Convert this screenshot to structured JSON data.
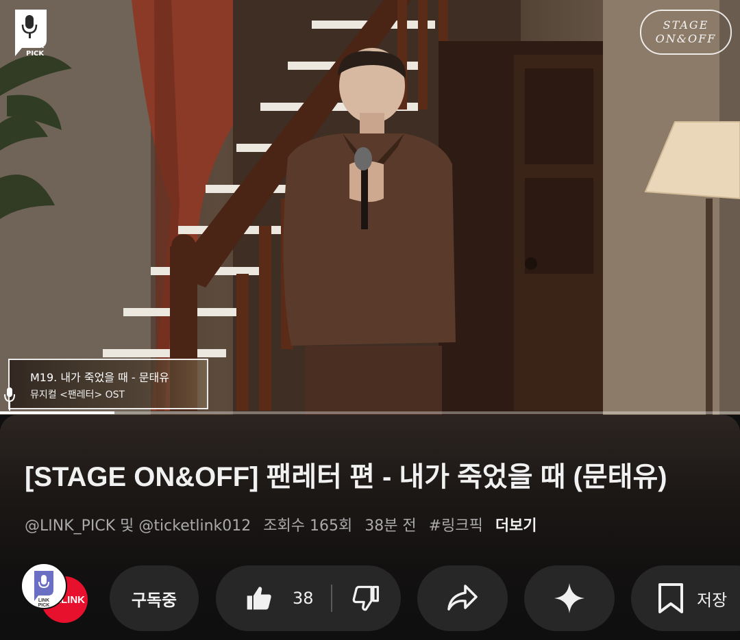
{
  "player": {
    "channel_logo_text": [
      "LINK",
      "PICK"
    ],
    "stage_badge": [
      "STAGE",
      "ON&OFF"
    ],
    "caption": {
      "title": "M19. 내가 죽었을 때 - 문태유",
      "subtitle": "뮤지컬 <팬레터> OST"
    },
    "progress_fraction": 0.155
  },
  "video": {
    "title": "[STAGE ON&OFF] 팬레터 편 - 내가 죽었을 때 (문태유)",
    "channels": "@LINK_PICK 및 @ticketlink012",
    "views": "조회수 165회",
    "time_ago": "38분 전",
    "hashtag": "#링크픽",
    "more_label": "더보기"
  },
  "actions": {
    "avatar_link_text": "tLINK",
    "subscribe_label": "구독중",
    "like_count": "38",
    "save_label": "저장",
    "icons": [
      "thumb-up-icon",
      "thumb-down-icon",
      "share-icon",
      "sparkle-icon",
      "bookmark-icon"
    ]
  },
  "colors": {
    "background": "#0f0f0f",
    "pill": "#272727",
    "ticketlink_red": "#e8112d",
    "logo_purple": "#6b6fc4"
  }
}
